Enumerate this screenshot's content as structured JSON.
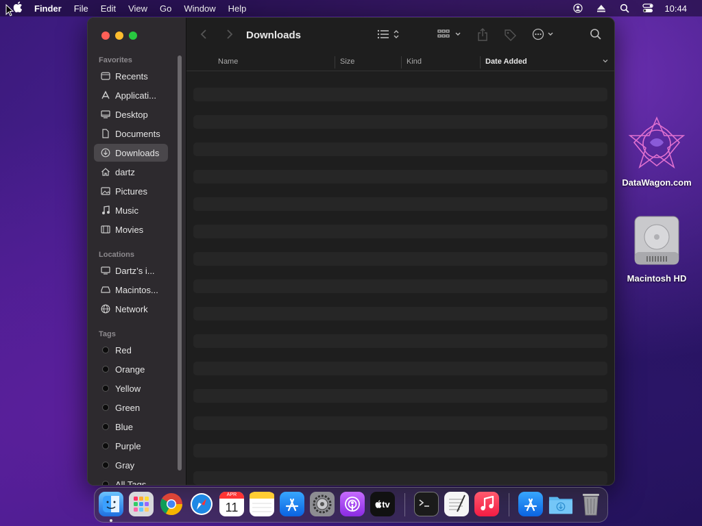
{
  "menubar": {
    "app": "Finder",
    "menus": [
      "File",
      "Edit",
      "View",
      "Go",
      "Window",
      "Help"
    ],
    "clock": "10:44",
    "status_icons": [
      "user-icon",
      "eject-icon",
      "search-icon",
      "control-center-icon"
    ]
  },
  "window": {
    "title": "Downloads",
    "sidebar": {
      "favorites_label": "Favorites",
      "favorites": [
        {
          "label": "Recents",
          "icon": "clock-icon"
        },
        {
          "label": "Applicati...",
          "icon": "applications-icon"
        },
        {
          "label": "Desktop",
          "icon": "desktop-icon"
        },
        {
          "label": "Documents",
          "icon": "document-icon"
        },
        {
          "label": "Downloads",
          "icon": "download-icon",
          "selected": true
        },
        {
          "label": "dartz",
          "icon": "home-icon"
        },
        {
          "label": "Pictures",
          "icon": "photo-icon"
        },
        {
          "label": "Music",
          "icon": "music-icon"
        },
        {
          "label": "Movies",
          "icon": "film-icon"
        }
      ],
      "locations_label": "Locations",
      "locations": [
        {
          "label": "Dartz’s i...",
          "icon": "computer-icon"
        },
        {
          "label": "Macintos...",
          "icon": "drive-icon"
        },
        {
          "label": "Network",
          "icon": "globe-icon"
        }
      ],
      "tags_label": "Tags",
      "tags": [
        {
          "label": "Red"
        },
        {
          "label": "Orange"
        },
        {
          "label": "Yellow"
        },
        {
          "label": "Green"
        },
        {
          "label": "Blue"
        },
        {
          "label": "Purple"
        },
        {
          "label": "Gray"
        },
        {
          "label": "All Tags..."
        }
      ]
    },
    "columns": {
      "name": "Name",
      "size": "Size",
      "kind": "Kind",
      "date_added": "Date Added"
    }
  },
  "desktop": {
    "icons": [
      {
        "label": "DataWagon.com"
      },
      {
        "label": "Macintosh HD"
      }
    ]
  },
  "dock": {
    "calendar_month": "APR",
    "calendar_day": "11",
    "tv_label": "tv"
  },
  "colors": {
    "accent": "#0a84ff",
    "close": "#fe5f57",
    "minimize": "#febc2e",
    "zoom": "#28c840"
  }
}
